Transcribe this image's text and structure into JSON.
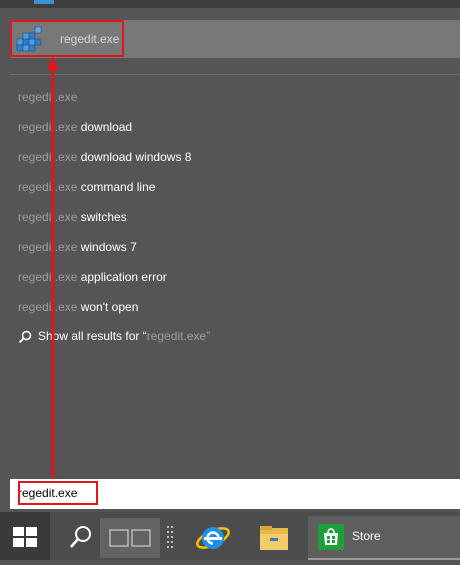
{
  "top_result": {
    "label": "regedit.exe",
    "icon": "registry-editor-icon"
  },
  "suggestions": [
    {
      "match": "regedit.exe",
      "suffix": ""
    },
    {
      "match": "regedit.exe",
      "suffix": " download"
    },
    {
      "match": "regedit.exe",
      "suffix": " download windows 8"
    },
    {
      "match": "regedit.exe",
      "suffix": " command line"
    },
    {
      "match": "regedit.exe",
      "suffix": " switches"
    },
    {
      "match": "regedit.exe",
      "suffix": " windows 7"
    },
    {
      "match": "regedit.exe",
      "suffix": " application error"
    },
    {
      "match": "regedit.exe",
      "suffix": " won't open"
    }
  ],
  "show_all": {
    "prefix": "Show all results for “",
    "query": "regedit.exe",
    "suffix": "”"
  },
  "search_box": {
    "value": "regedit.exe"
  },
  "taskbar": {
    "store_label": "Store"
  },
  "colors": {
    "annotation_red": "#e0161c",
    "panel_bg": "#555555",
    "selected_bg": "#787878"
  }
}
